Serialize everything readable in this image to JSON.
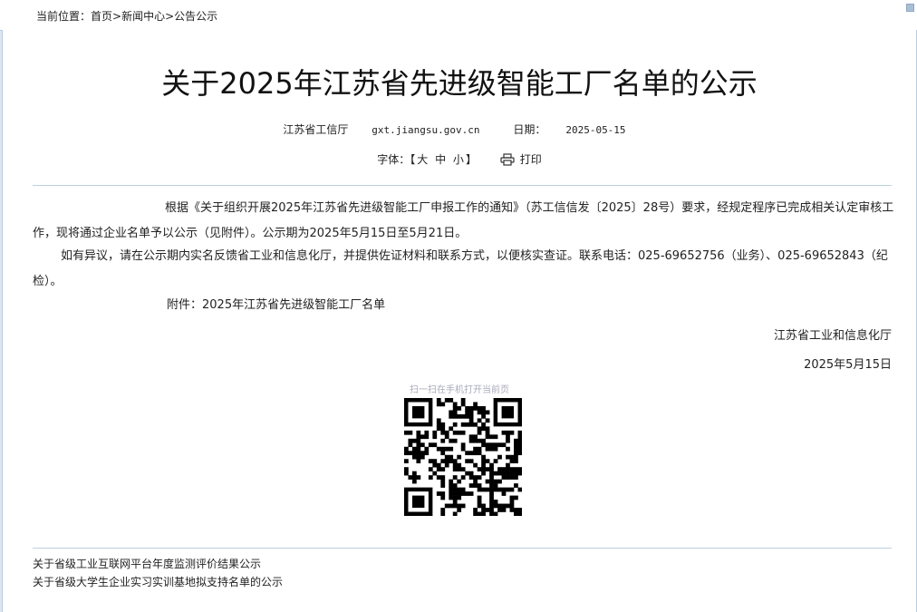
{
  "breadcrumb": {
    "prefix": "当前位置：",
    "home": "首页",
    "sep1": ">",
    "news": "新闻中心",
    "sep2": ">",
    "current": "公告公示"
  },
  "article": {
    "title": "关于2025年江苏省先进级智能工厂名单的公示",
    "source": "江苏省工信厅",
    "site": "gxt.jiangsu.gov.cn",
    "date_label": "日期：",
    "date": "2025-05-15"
  },
  "tools": {
    "font_label": "字体：",
    "bracket_open": "【",
    "large": "大",
    "medium": "中",
    "small": "小",
    "bracket_close": "】",
    "print": "打印"
  },
  "body": {
    "p1": "根据《关于组织开展2025年江苏省先进级智能工厂申报工作的通知》（苏工信信发〔2025〕28号）要求，经规定程序已完成相关认定审核工作，现将通过企业名单予以公示（见附件）。公示期为2025年5月15日至5月21日。",
    "p2": "如有异议，请在公示期内实名反馈省工业和信息化厅，并提供佐证材料和联系方式，以便核实查证。联系电话：025-69652756（业务）、025-69652843（纪检）。",
    "attachment": "附件：2025年江苏省先进级智能工厂名单",
    "signature": "江苏省工业和信息化厅",
    "sign_date": "2025年5月15日"
  },
  "qr": {
    "caption": "扫一扫在手机打开当前页"
  },
  "related": [
    "关于省级工业互联网平台年度监测评价结果公示",
    "关于省级大学生企业实习实训基地拟支持名单的公示"
  ]
}
